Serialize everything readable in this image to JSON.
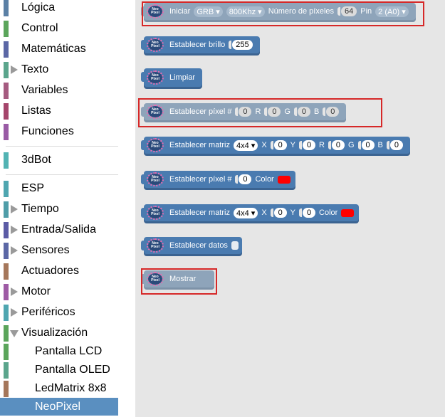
{
  "toolbox": {
    "categories": [
      {
        "label": "Lógica",
        "color": "#5b80a5"
      },
      {
        "label": "Control",
        "color": "#5ba55b"
      },
      {
        "label": "Matemáticas",
        "color": "#5b67a5"
      },
      {
        "label": "Texto",
        "color": "#5ba58c"
      },
      {
        "label": "Variables",
        "color": "#a55b80"
      },
      {
        "label": "Listas",
        "color": "#a5456b"
      },
      {
        "label": "Funciones",
        "color": "#995ba5"
      },
      {
        "label": "3dBot",
        "color": "#52b3b3"
      },
      {
        "label": "ESP",
        "color": "#4fa6b0"
      },
      {
        "label": "Tiempo",
        "color": "#4f9da8"
      },
      {
        "label": "Entrada/Salida",
        "color": "#5b5ba5"
      },
      {
        "label": "Sensores",
        "color": "#5b67a5"
      },
      {
        "label": "Actuadores",
        "color": "#a5775b"
      },
      {
        "label": "Motor",
        "color": "#9e5ba5"
      },
      {
        "label": "Periféricos",
        "color": "#4fa6b0"
      },
      {
        "label": "Visualización",
        "color": "#5ba55b"
      },
      {
        "label": "Pantalla LCD",
        "color": "#5ba55b"
      },
      {
        "label": "Pantalla OLED",
        "color": "#5ba58c"
      },
      {
        "label": "LedMatrix 8x8",
        "color": "#a5775b"
      },
      {
        "label": "NeoPixel",
        "color": "#5a8fc0"
      }
    ]
  },
  "blocks": {
    "icon_text": "Neo\nPixel",
    "init": {
      "label": "Iniciar",
      "mode": "GRB",
      "freq": "800Khz",
      "count_label": "Número de píxeles",
      "count": "64",
      "pin_label": "Pin",
      "pin": "2 (A0)"
    },
    "brightness": {
      "label": "Establecer brillo",
      "value": "255"
    },
    "clear": {
      "label": "Limpiar"
    },
    "pixel_rgb": {
      "label": "Establecer píxel #",
      "index": "0",
      "r_label": "R",
      "r": "0",
      "g_label": "G",
      "g": "0",
      "b_label": "B",
      "b": "0"
    },
    "matrix_rgb": {
      "label": "Establecer matriz",
      "size": "4x4",
      "x_label": "X",
      "x": "0",
      "y_label": "Y",
      "y": "0",
      "r_label": "R",
      "r": "0",
      "g_label": "G",
      "g": "0",
      "b_label": "B",
      "b": "0"
    },
    "pixel_color": {
      "label": "Establecer píxel #",
      "index": "0",
      "color_label": "Color",
      "color": "#ff0000"
    },
    "matrix_color": {
      "label": "Establecer matriz",
      "size": "4x4",
      "x_label": "X",
      "x": "0",
      "y_label": "Y",
      "y": "0",
      "color_label": "Color",
      "color": "#ff0000"
    },
    "data": {
      "label": "Establecer datos"
    },
    "show": {
      "label": "Mostrar"
    }
  },
  "dropdown_arrow": "▾",
  "highlight_color": "#d62828"
}
